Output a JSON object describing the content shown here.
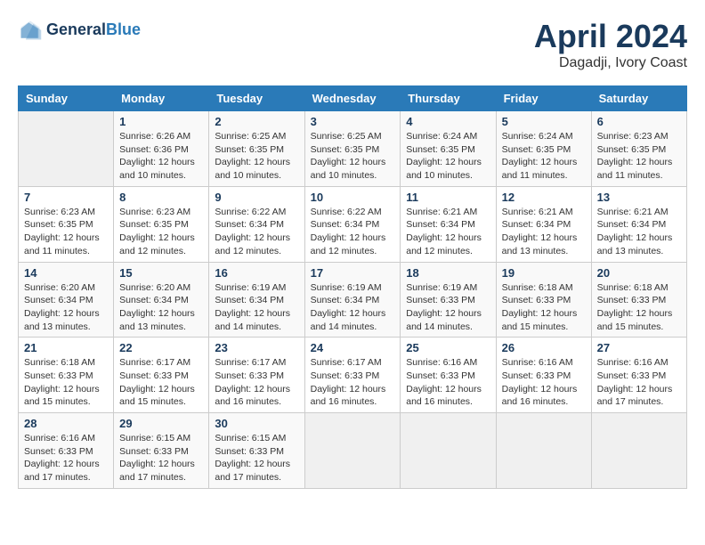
{
  "header": {
    "logo_line1": "General",
    "logo_line2": "Blue",
    "month_year": "April 2024",
    "location": "Dagadji, Ivory Coast"
  },
  "days_of_week": [
    "Sunday",
    "Monday",
    "Tuesday",
    "Wednesday",
    "Thursday",
    "Friday",
    "Saturday"
  ],
  "weeks": [
    [
      {
        "day": "",
        "info": ""
      },
      {
        "day": "1",
        "info": "Sunrise: 6:26 AM\nSunset: 6:36 PM\nDaylight: 12 hours\nand 10 minutes."
      },
      {
        "day": "2",
        "info": "Sunrise: 6:25 AM\nSunset: 6:35 PM\nDaylight: 12 hours\nand 10 minutes."
      },
      {
        "day": "3",
        "info": "Sunrise: 6:25 AM\nSunset: 6:35 PM\nDaylight: 12 hours\nand 10 minutes."
      },
      {
        "day": "4",
        "info": "Sunrise: 6:24 AM\nSunset: 6:35 PM\nDaylight: 12 hours\nand 10 minutes."
      },
      {
        "day": "5",
        "info": "Sunrise: 6:24 AM\nSunset: 6:35 PM\nDaylight: 12 hours\nand 11 minutes."
      },
      {
        "day": "6",
        "info": "Sunrise: 6:23 AM\nSunset: 6:35 PM\nDaylight: 12 hours\nand 11 minutes."
      }
    ],
    [
      {
        "day": "7",
        "info": "Sunrise: 6:23 AM\nSunset: 6:35 PM\nDaylight: 12 hours\nand 11 minutes."
      },
      {
        "day": "8",
        "info": "Sunrise: 6:23 AM\nSunset: 6:35 PM\nDaylight: 12 hours\nand 12 minutes."
      },
      {
        "day": "9",
        "info": "Sunrise: 6:22 AM\nSunset: 6:34 PM\nDaylight: 12 hours\nand 12 minutes."
      },
      {
        "day": "10",
        "info": "Sunrise: 6:22 AM\nSunset: 6:34 PM\nDaylight: 12 hours\nand 12 minutes."
      },
      {
        "day": "11",
        "info": "Sunrise: 6:21 AM\nSunset: 6:34 PM\nDaylight: 12 hours\nand 12 minutes."
      },
      {
        "day": "12",
        "info": "Sunrise: 6:21 AM\nSunset: 6:34 PM\nDaylight: 12 hours\nand 13 minutes."
      },
      {
        "day": "13",
        "info": "Sunrise: 6:21 AM\nSunset: 6:34 PM\nDaylight: 12 hours\nand 13 minutes."
      }
    ],
    [
      {
        "day": "14",
        "info": "Sunrise: 6:20 AM\nSunset: 6:34 PM\nDaylight: 12 hours\nand 13 minutes."
      },
      {
        "day": "15",
        "info": "Sunrise: 6:20 AM\nSunset: 6:34 PM\nDaylight: 12 hours\nand 13 minutes."
      },
      {
        "day": "16",
        "info": "Sunrise: 6:19 AM\nSunset: 6:34 PM\nDaylight: 12 hours\nand 14 minutes."
      },
      {
        "day": "17",
        "info": "Sunrise: 6:19 AM\nSunset: 6:34 PM\nDaylight: 12 hours\nand 14 minutes."
      },
      {
        "day": "18",
        "info": "Sunrise: 6:19 AM\nSunset: 6:33 PM\nDaylight: 12 hours\nand 14 minutes."
      },
      {
        "day": "19",
        "info": "Sunrise: 6:18 AM\nSunset: 6:33 PM\nDaylight: 12 hours\nand 15 minutes."
      },
      {
        "day": "20",
        "info": "Sunrise: 6:18 AM\nSunset: 6:33 PM\nDaylight: 12 hours\nand 15 minutes."
      }
    ],
    [
      {
        "day": "21",
        "info": "Sunrise: 6:18 AM\nSunset: 6:33 PM\nDaylight: 12 hours\nand 15 minutes."
      },
      {
        "day": "22",
        "info": "Sunrise: 6:17 AM\nSunset: 6:33 PM\nDaylight: 12 hours\nand 15 minutes."
      },
      {
        "day": "23",
        "info": "Sunrise: 6:17 AM\nSunset: 6:33 PM\nDaylight: 12 hours\nand 16 minutes."
      },
      {
        "day": "24",
        "info": "Sunrise: 6:17 AM\nSunset: 6:33 PM\nDaylight: 12 hours\nand 16 minutes."
      },
      {
        "day": "25",
        "info": "Sunrise: 6:16 AM\nSunset: 6:33 PM\nDaylight: 12 hours\nand 16 minutes."
      },
      {
        "day": "26",
        "info": "Sunrise: 6:16 AM\nSunset: 6:33 PM\nDaylight: 12 hours\nand 16 minutes."
      },
      {
        "day": "27",
        "info": "Sunrise: 6:16 AM\nSunset: 6:33 PM\nDaylight: 12 hours\nand 17 minutes."
      }
    ],
    [
      {
        "day": "28",
        "info": "Sunrise: 6:16 AM\nSunset: 6:33 PM\nDaylight: 12 hours\nand 17 minutes."
      },
      {
        "day": "29",
        "info": "Sunrise: 6:15 AM\nSunset: 6:33 PM\nDaylight: 12 hours\nand 17 minutes."
      },
      {
        "day": "30",
        "info": "Sunrise: 6:15 AM\nSunset: 6:33 PM\nDaylight: 12 hours\nand 17 minutes."
      },
      {
        "day": "",
        "info": ""
      },
      {
        "day": "",
        "info": ""
      },
      {
        "day": "",
        "info": ""
      },
      {
        "day": "",
        "info": ""
      }
    ]
  ]
}
